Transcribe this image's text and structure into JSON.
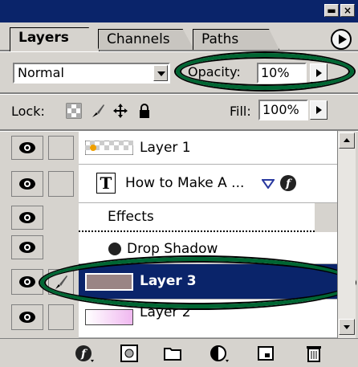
{
  "tabs": [
    {
      "label": "Layers",
      "active": true
    },
    {
      "label": "Channels",
      "active": false
    },
    {
      "label": "Paths",
      "active": false
    }
  ],
  "blend_mode": "Normal",
  "opacity": {
    "label": "Opacity:",
    "value": "10%"
  },
  "lock": {
    "label": "Lock:"
  },
  "fill": {
    "label": "Fill:",
    "value": "100%"
  },
  "layers": [
    {
      "name": "Layer 1",
      "type": "image",
      "visible": true
    },
    {
      "name": "How to Make A ...",
      "type": "text",
      "visible": true,
      "has_effects": true
    },
    {
      "name": "Effects",
      "type": "effects-header",
      "visible": true
    },
    {
      "name": "Drop Shadow",
      "type": "effect",
      "visible": true
    },
    {
      "name": "Layer 3",
      "type": "image",
      "visible": true,
      "selected": true
    },
    {
      "name": "Layer 2",
      "type": "image",
      "visible": true
    }
  ],
  "colors": {
    "selected_row": "#0a246a",
    "highlight_oval": "#006633",
    "layer3_swatch": "#9a8585"
  }
}
